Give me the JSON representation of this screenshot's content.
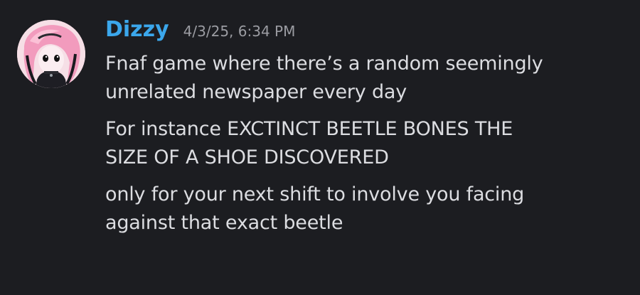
{
  "message": {
    "author": "Dizzy",
    "timestamp": "4/3/25, 6:34 PM",
    "lines": [
      "Fnaf game where there’s a random seemingly\nunrelated newspaper every day",
      "For instance EXCTINCT BEETLE BONES THE\nSIZE OF A SHOE DISCOVERED",
      "only for your next shift to involve you facing\nagainst that exact beetle"
    ]
  },
  "colors": {
    "background": "#1c1d21",
    "username": "#3ba7ec",
    "timestamp": "#9b9ca2",
    "text": "#dcdde1"
  }
}
